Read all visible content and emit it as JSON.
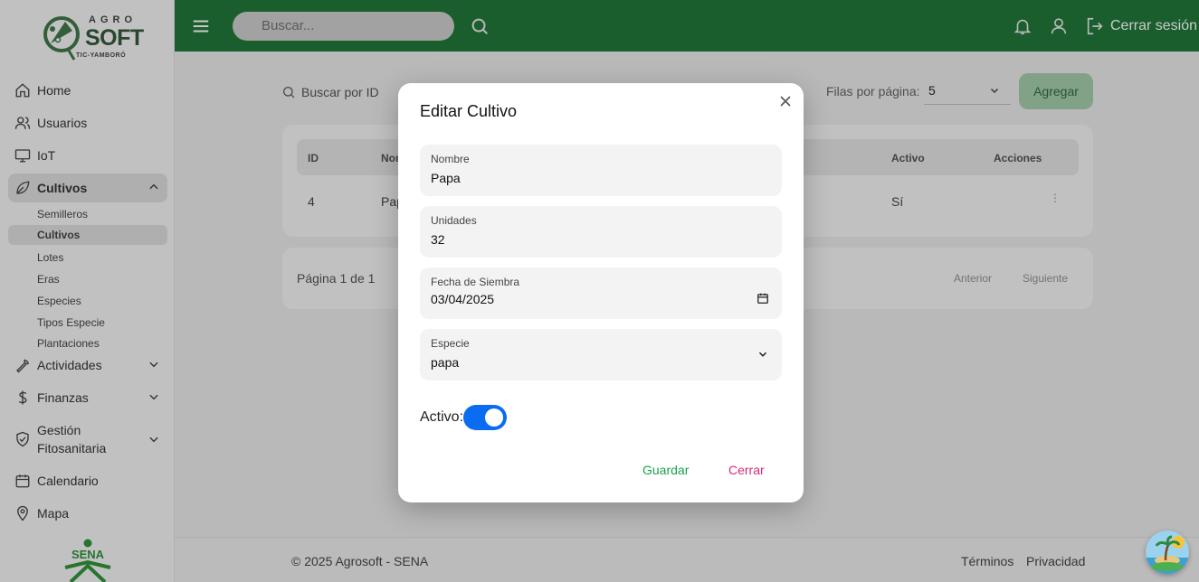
{
  "logo": {
    "top": "AGRO",
    "main": "SOFT",
    "sub": "TIC-YAMBORÓ"
  },
  "sidebar": {
    "items": [
      {
        "label": "Home",
        "icon": "home-icon"
      },
      {
        "label": "Usuarios",
        "icon": "users-icon"
      },
      {
        "label": "IoT",
        "icon": "monitor-icon"
      },
      {
        "label": "Cultivos",
        "icon": "leaf-icon"
      },
      {
        "label": "Actividades",
        "icon": "wrench-icon"
      },
      {
        "label": "Finanzas",
        "icon": "dollar-icon"
      },
      {
        "label": "Gestión Fitosanitaria",
        "icon": "shield-icon"
      },
      {
        "label": "Calendario",
        "icon": "calendar-icon"
      },
      {
        "label": "Mapa",
        "icon": "map-pin-icon"
      }
    ],
    "sub_items": [
      "Semilleros",
      "Cultivos",
      "Lotes",
      "Eras",
      "Especies",
      "Tipos Especie",
      "Plantaciones"
    ],
    "sena_label": "SENA"
  },
  "topbar": {
    "search_placeholder": "Buscar...",
    "logout_label": "Cerrar sesión"
  },
  "page": {
    "search_placeholder": "Buscar por ID",
    "rows_per_page_label": "Filas por página:",
    "rows_per_page_value": "5",
    "add_button": "Agregar",
    "table": {
      "headers": [
        "ID",
        "Nombre",
        "Activo",
        "Acciones"
      ],
      "rows": [
        {
          "id": "4",
          "nombre": "Papa",
          "activo": "Sí"
        }
      ]
    },
    "pagination": {
      "label": "Página 1 de 1",
      "prev": "Anterior",
      "next": "Siguiente"
    }
  },
  "footer": {
    "copyright": "© 2025 Agrosoft - SENA",
    "terms": "Términos",
    "privacy": "Privacidad"
  },
  "modal": {
    "title": "Editar Cultivo",
    "fields": [
      {
        "label": "Nombre",
        "value": "Papa"
      },
      {
        "label": "Unidades",
        "value": "32"
      },
      {
        "label": "Fecha de Siembra",
        "value": "03/04/2025"
      },
      {
        "label": "Especie",
        "value": "papa"
      }
    ],
    "active_label": "Activo:",
    "active_value": true,
    "save_button": "Guardar",
    "close_button": "Cerrar"
  },
  "colors": {
    "topbar": "#0d6b27",
    "toggle": "#0a6cf0",
    "save": "#16a34a",
    "close": "#db2777"
  }
}
